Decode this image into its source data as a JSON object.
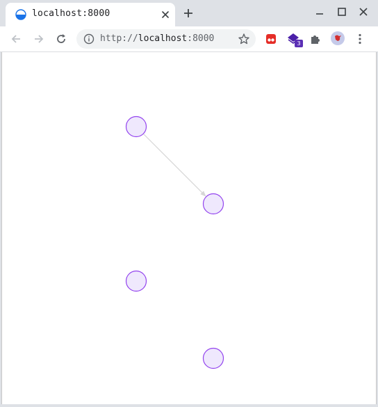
{
  "browser": {
    "tab_title": "localhost:8000",
    "url_scheme": "http://",
    "url_host": "localhost",
    "url_port": ":8000",
    "extension_badge": "3"
  },
  "icons": {
    "favicon": "half-filled-circle-icon",
    "close": "close-icon",
    "new_tab": "plus-icon",
    "minimize": "minimize-icon",
    "maximize": "maximize-icon",
    "window_close": "close-icon",
    "back": "arrow-left-icon",
    "forward": "arrow-right-icon",
    "reload": "reload-icon",
    "info": "info-icon",
    "bookmark": "star-icon",
    "extension_red": "red-extension-icon",
    "extension_purple": "purple-stack-icon",
    "extensions": "puzzle-icon",
    "profile": "avatar",
    "menu": "kebab-menu-icon"
  },
  "graph": {
    "node_fill": "#efe8fd",
    "node_stroke": "#9343ee",
    "edge_color": "#d6d6d6",
    "nodes": [
      {
        "id": "a"
      },
      {
        "id": "b"
      },
      {
        "id": "c"
      },
      {
        "id": "d"
      }
    ],
    "edges": [
      {
        "from": "a",
        "to": "b"
      }
    ]
  }
}
